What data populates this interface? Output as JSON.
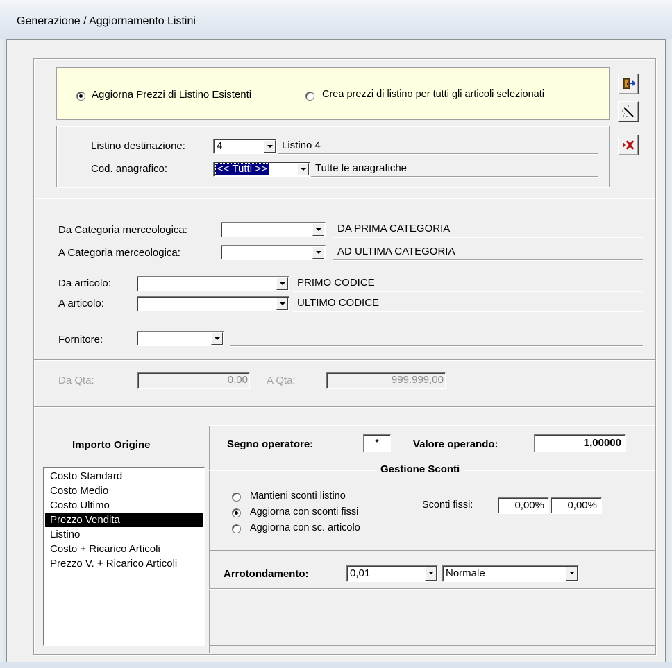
{
  "window": {
    "title": "Generazione / Aggiornamento Listini"
  },
  "mode": {
    "option_update": "Aggiorna Prezzi di Listino Esistenti",
    "option_create": "Crea prezzi di listino per tutti gli articoli selezionati",
    "selected": "update"
  },
  "destination": {
    "listino_label": "Listino destinazione:",
    "listino_value": "4",
    "listino_desc": "Listino 4",
    "anagrafico_label": "Cod. anagrafico:",
    "anagrafico_value": "<< Tutti >>",
    "anagrafico_desc": "Tutte le anagrafiche"
  },
  "toolbar": {
    "exit_icon": "exit-door-icon",
    "wand_icon": "magic-wand-icon",
    "cancel_icon": "cancel-x-icon"
  },
  "filters": {
    "da_categoria_label": "Da Categoria merceologica:",
    "da_categoria_value": "",
    "da_categoria_desc": "DA PRIMA CATEGORIA",
    "a_categoria_label": "A Categoria merceologica:",
    "a_categoria_value": "",
    "a_categoria_desc": "AD ULTIMA CATEGORIA",
    "da_articolo_label": "Da articolo:",
    "da_articolo_value": "",
    "da_articolo_desc": "PRIMO CODICE",
    "a_articolo_label": "A articolo:",
    "a_articolo_value": "",
    "a_articolo_desc": "ULTIMO CODICE",
    "fornitore_label": "Fornitore:",
    "fornitore_value": "",
    "fornitore_desc": ""
  },
  "quantity": {
    "da_qta_label": "Da Qta:",
    "da_qta_value": "0,00",
    "a_qta_label": "A Qta:",
    "a_qta_value": "999.999,00"
  },
  "source": {
    "title": "Importo Origine",
    "items": [
      "Costo Standard",
      "Costo Medio",
      "Costo Ultimo",
      "Prezzo Vendita",
      "Listino",
      "Costo + Ricarico Articoli",
      "Prezzo V. + Ricarico Articoli"
    ],
    "selected_index": 3
  },
  "operation": {
    "segno_label": "Segno operatore:",
    "segno_value": "*",
    "valore_label": "Valore operando:",
    "valore_value": "1,00000"
  },
  "sconti": {
    "title": "Gestione Sconti",
    "option_keep": "Mantieni sconti listino",
    "option_fixed": "Aggiorna con sconti fissi",
    "option_article": "Aggiorna con sc. articolo",
    "selected": "fixed",
    "fissi_label": "Sconti fissi:",
    "fisso1": "0,00%",
    "fisso2": "0,00%"
  },
  "rounding": {
    "label": "Arrotondamento:",
    "step_value": "0,01",
    "mode_value": "Normale"
  }
}
